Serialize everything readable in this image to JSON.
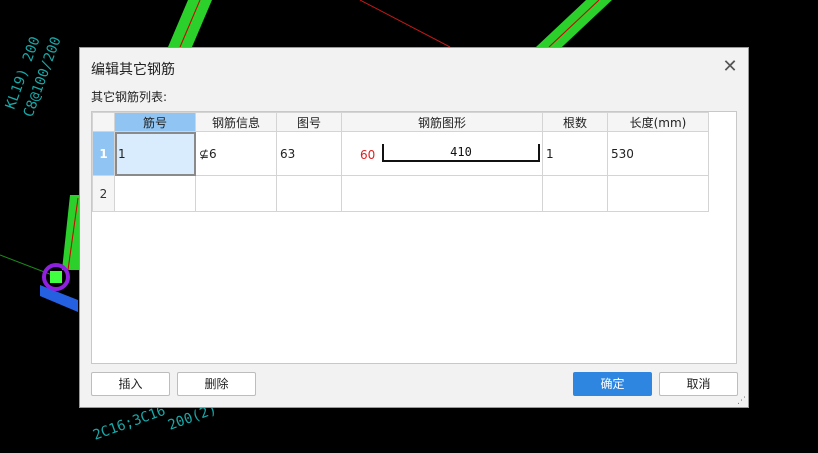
{
  "dialog": {
    "title": "编辑其它钢筋",
    "list_label": "其它钢筋列表:"
  },
  "grid": {
    "columns": [
      "筋号",
      "钢筋信息",
      "图号",
      "钢筋图形",
      "根数",
      "长度(mm)"
    ],
    "rows": [
      {
        "num": "1",
        "bar_no": "1",
        "bar_info": "⊈6",
        "fig_no": "63",
        "shape": {
          "left": "60",
          "middle": "410"
        },
        "count": "1",
        "length": "530"
      },
      {
        "num": "2",
        "bar_no": "",
        "bar_info": "",
        "fig_no": "",
        "shape": {
          "left": "",
          "middle": ""
        },
        "count": "",
        "length": ""
      }
    ]
  },
  "buttons": {
    "insert": "插入",
    "delete": "删除",
    "ok": "确定",
    "cancel": "取消"
  },
  "colors": {
    "accent": "#2f86e0",
    "selected_header": "#8fc4f3",
    "shape_red": "#e02020"
  }
}
